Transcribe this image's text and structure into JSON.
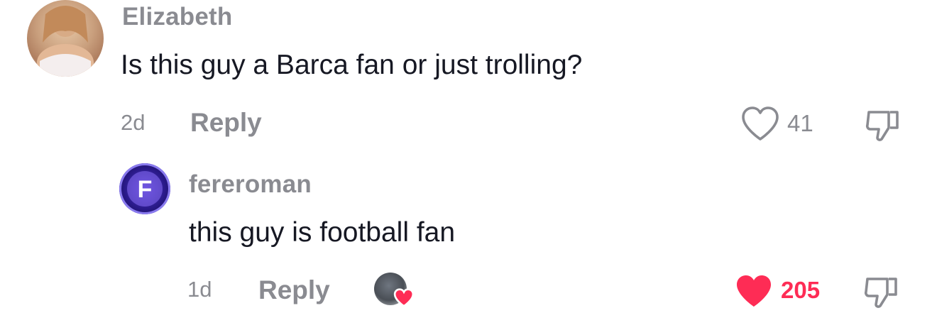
{
  "comments": [
    {
      "username": "Elizabeth",
      "text": "Is this guy a Barca fan or just trolling?",
      "time": "2d",
      "reply_label": "Reply",
      "likes": "41",
      "liked": false
    },
    {
      "username": "fereroman",
      "avatar_letter": "F",
      "text": "this guy is football fan",
      "time": "1d",
      "reply_label": "Reply",
      "likes": "205",
      "liked": true
    }
  ],
  "colors": {
    "muted": "#8a8b91",
    "text": "#161823",
    "like_red": "#fe2c55"
  },
  "icons": {
    "like": "heart-icon",
    "dislike": "thumbs-down-icon",
    "creator_liked": "creator-liked-heart-icon"
  }
}
